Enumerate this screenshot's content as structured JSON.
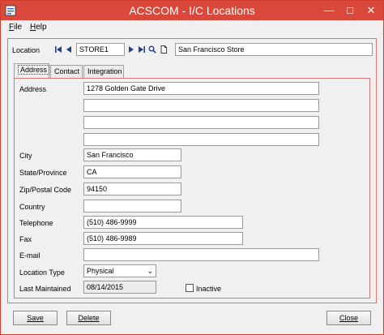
{
  "window": {
    "title": "ACSCOM - I/C Locations"
  },
  "menu": [
    {
      "label": "File",
      "mnemonic": "F",
      "rest": "ile"
    },
    {
      "label": "Help",
      "mnemonic": "H",
      "rest": "elp"
    }
  ],
  "location": {
    "label": "Location",
    "code": "STORE1",
    "description": "San Francisco Store"
  },
  "tabs": [
    {
      "label": "Address",
      "active": true
    },
    {
      "label": "Contact",
      "active": false
    },
    {
      "label": "Integration",
      "active": false
    }
  ],
  "address": {
    "label": "Address",
    "lines": [
      "1278 Golden Gate Drive",
      "",
      "",
      ""
    ],
    "city_label": "City",
    "city": "San Francisco",
    "state_label": "State/Province",
    "state": "CA",
    "zip_label": "Zip/Postal Code",
    "zip": "94150",
    "country_label": "Country",
    "country": "",
    "telephone_label": "Telephone",
    "telephone": "(510) 486-9999",
    "fax_label": "Fax",
    "fax": "(510) 486-9989",
    "email_label": "E-mail",
    "email": "",
    "location_type_label": "Location Type",
    "location_type": "Physical",
    "last_maintained_label": "Last Maintained",
    "last_maintained": "08/14/2015",
    "inactive_label": "Inactive",
    "inactive": false
  },
  "buttons": {
    "save": "Save",
    "delete": "Delete",
    "close": "Close"
  },
  "colors": {
    "titlebar": "#d9483b",
    "frame": "#d87777"
  }
}
